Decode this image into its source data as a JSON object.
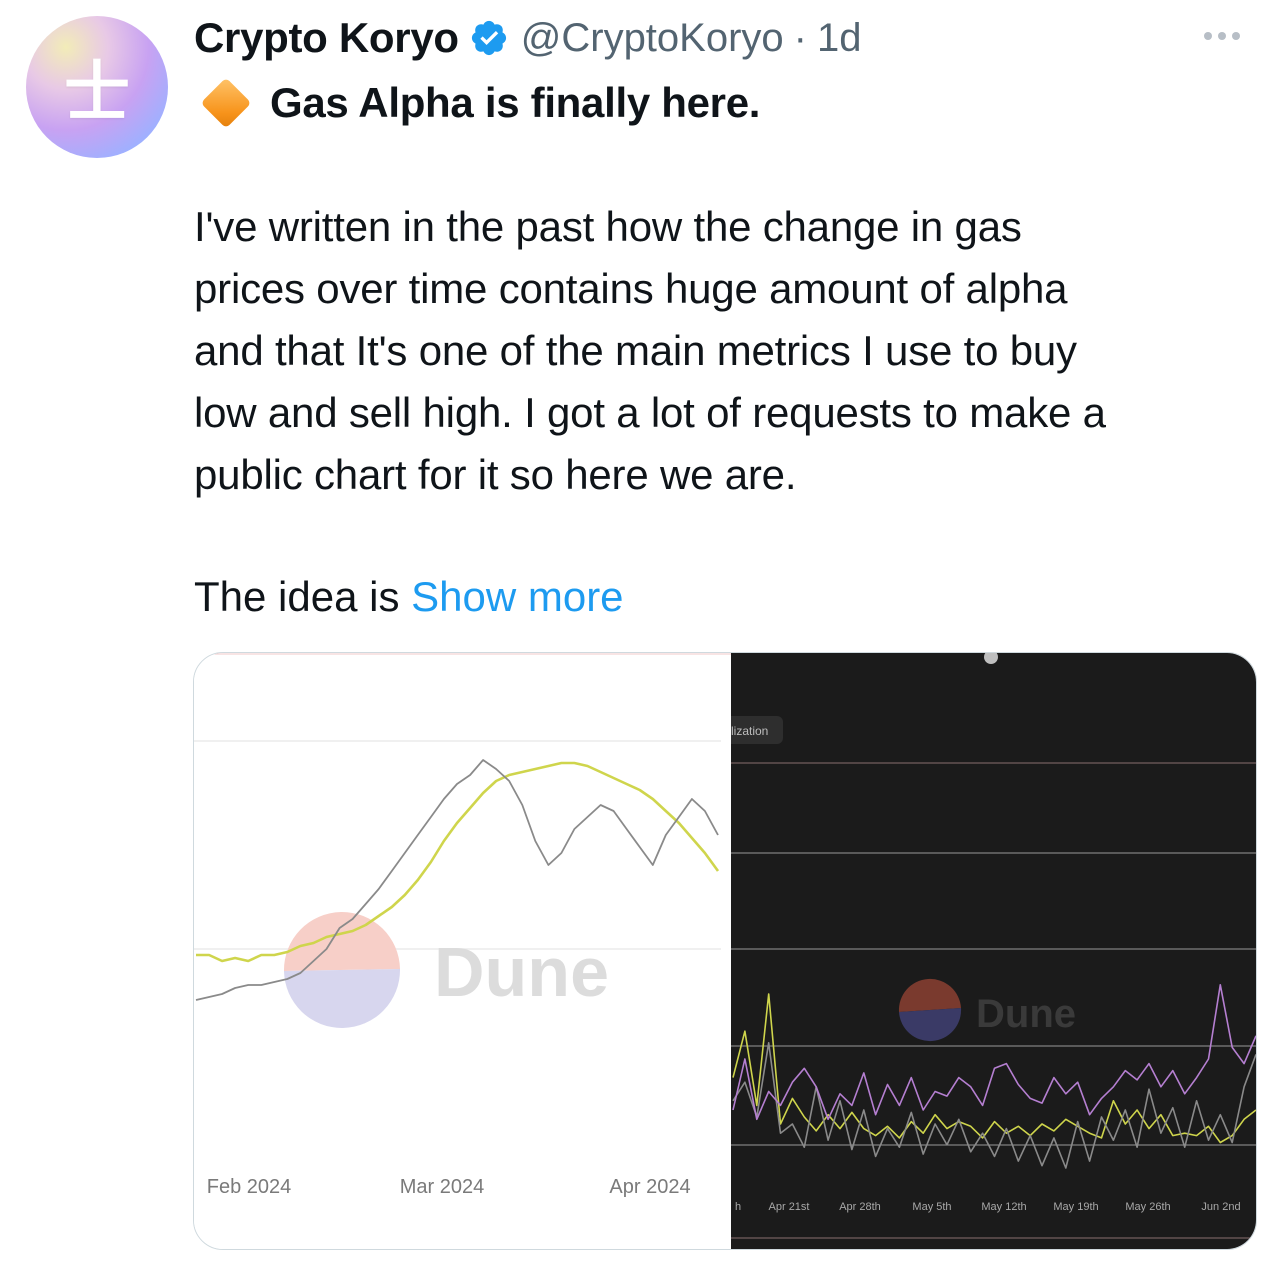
{
  "tweet": {
    "author_name": "Crypto Koryo",
    "handle": "@CryptoKoryo",
    "separator": "·",
    "time": "1d",
    "avatar_glyph": "士",
    "headline": "Gas Alpha is finally here.",
    "headline_icon": "orange-diamond-icon",
    "body_lines": [
      "I've written in the past how the change in gas",
      "prices over time contains huge amount of alpha",
      "and that It's one of the main metrics I use to buy",
      "low and sell high. I got a lot of requests to make a",
      "public chart for it so here we are."
    ],
    "idea_prefix": "The idea is ",
    "show_more": "Show more"
  },
  "colors": {
    "link": "#1d9bf0",
    "verified": "#1d9bf0",
    "secondary_text": "#536471",
    "chart_yellow": "#cfd54c",
    "chart_gray": "#8a8a8a",
    "chart_purple": "#b57fd1"
  },
  "chart_data": [
    {
      "type": "line",
      "watermark": "Dune",
      "x_tick_labels": [
        "Feb 2024",
        "Mar 2024",
        "Apr 2024"
      ],
      "series": [
        {
          "color": "#cfd54c",
          "values": [
            30,
            30,
            28,
            29,
            28,
            30,
            30,
            31,
            33,
            34,
            36,
            37,
            38,
            40,
            43,
            46,
            50,
            55,
            61,
            68,
            74,
            79,
            84,
            88,
            90,
            91,
            92,
            93,
            94,
            94,
            93,
            91,
            89,
            87,
            85,
            82,
            78,
            74,
            69,
            64,
            58
          ]
        },
        {
          "color": "#8a8a8a",
          "values": [
            15,
            16,
            17,
            19,
            20,
            20,
            21,
            22,
            24,
            28,
            32,
            39,
            42,
            47,
            52,
            58,
            64,
            70,
            76,
            82,
            87,
            90,
            95,
            92,
            88,
            80,
            68,
            60,
            64,
            72,
            76,
            80,
            78,
            72,
            66,
            60,
            70,
            76,
            82,
            78,
            70
          ]
        }
      ]
    },
    {
      "type": "line",
      "watermark": "Dune",
      "top_label": "lization",
      "x_tick_labels": [
        "h",
        "Apr 21st",
        "Apr 28th",
        "May 5th",
        "May 12th",
        "May 19th",
        "May 26th",
        "Jun 2nd"
      ],
      "series": [
        {
          "color": "#cfd54c",
          "values": [
            42,
            62,
            30,
            78,
            22,
            33,
            25,
            19,
            26,
            20,
            27,
            20,
            17,
            21,
            16,
            23,
            18,
            26,
            20,
            23,
            21,
            16,
            23,
            18,
            21,
            17,
            22,
            19,
            24,
            21,
            18,
            16,
            32,
            22,
            28,
            20,
            26,
            17,
            18,
            17,
            21,
            14,
            17,
            24,
            28
          ]
        },
        {
          "color": "#8a8a8a",
          "values": [
            32,
            40,
            25,
            57,
            18,
            22,
            12,
            38,
            15,
            32,
            11,
            28,
            8,
            20,
            12,
            27,
            9,
            22,
            13,
            24,
            10,
            18,
            8,
            20,
            6,
            17,
            4,
            16,
            3,
            23,
            6,
            25,
            15,
            28,
            12,
            37,
            18,
            29,
            12,
            32,
            15,
            26,
            14,
            38,
            52
          ]
        },
        {
          "color": "#b57fd1",
          "values": [
            28,
            50,
            24,
            36,
            30,
            40,
            46,
            38,
            24,
            35,
            30,
            44,
            26,
            39,
            30,
            42,
            28,
            36,
            34,
            42,
            38,
            30,
            46,
            48,
            39,
            33,
            31,
            42,
            35,
            40,
            26,
            33,
            38,
            45,
            41,
            48,
            38,
            45,
            35,
            42,
            50,
            82,
            55,
            48,
            60
          ]
        }
      ]
    }
  ]
}
